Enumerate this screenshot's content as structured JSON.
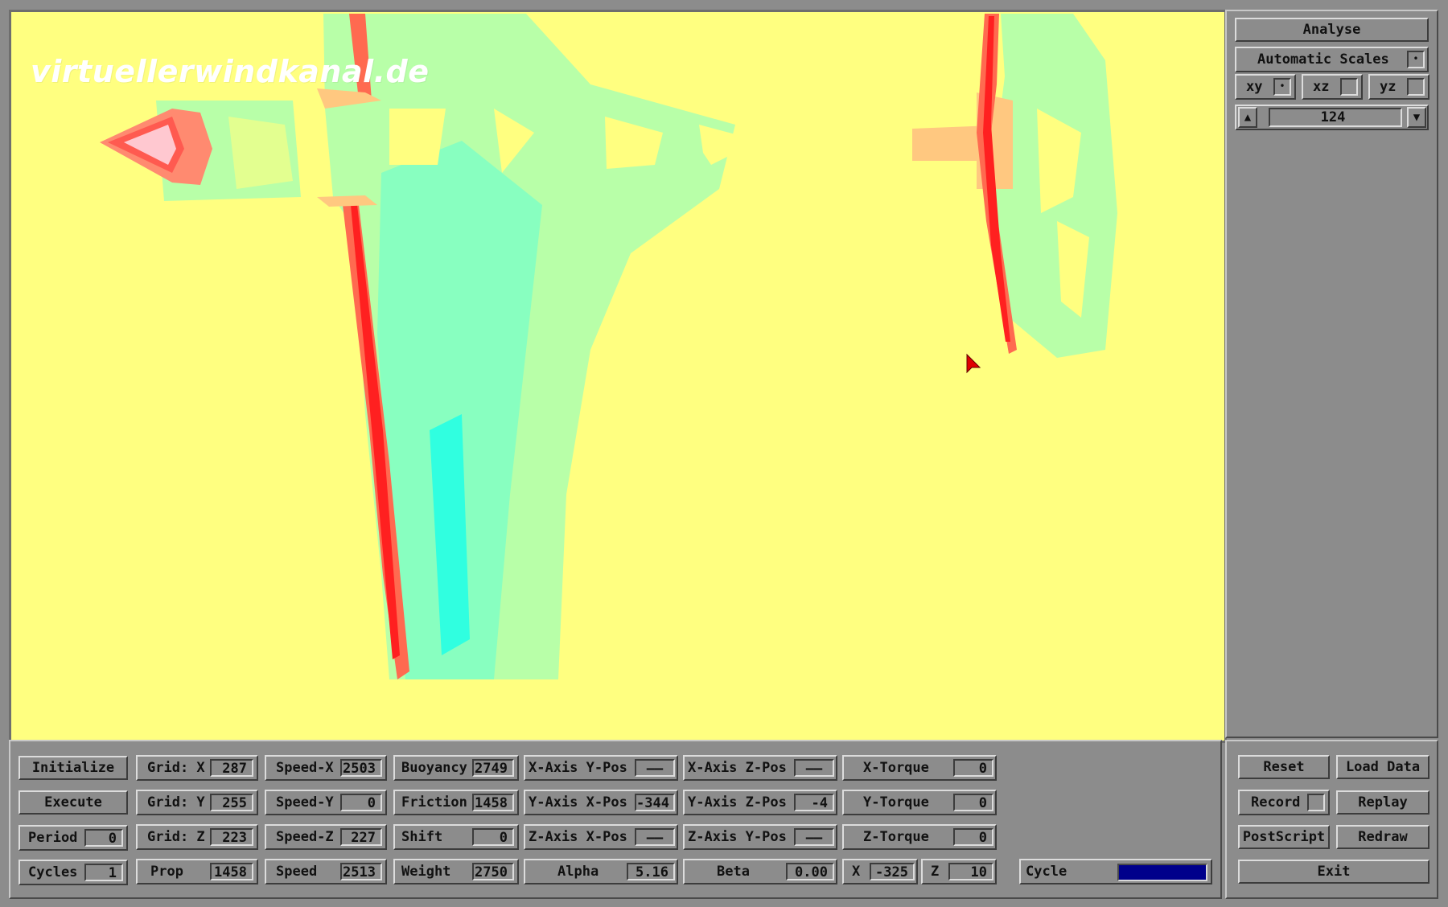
{
  "watermark": "virtuellerwindkanal.de",
  "colors": {
    "background": "#ffff80",
    "panel": "#8c8c8c",
    "cycle_bar": "#00008b"
  },
  "right_panel": {
    "analyse": "Analyse",
    "auto_scales": "Automatic Scales",
    "auto_scales_checked": true,
    "planes": [
      {
        "label": "xy",
        "checked": true
      },
      {
        "label": "xz",
        "checked": false
      },
      {
        "label": "yz",
        "checked": false
      }
    ],
    "slice_value": "124"
  },
  "bottom": {
    "initialize": "Initialize",
    "execute": "Execute",
    "period": {
      "label": "Period",
      "value": "0"
    },
    "cycles": {
      "label": "Cycles",
      "value": "1"
    },
    "grid_x": {
      "label": "Grid: X",
      "value": "287"
    },
    "grid_y": {
      "label": "Grid: Y",
      "value": "255"
    },
    "grid_z": {
      "label": "Grid: Z",
      "value": "223"
    },
    "prop": {
      "label": "Prop",
      "value": "1458"
    },
    "speed_x": {
      "label": "Speed-X",
      "value": "2503"
    },
    "speed_y": {
      "label": "Speed-Y",
      "value": "0"
    },
    "speed_z": {
      "label": "Speed-Z",
      "value": "227"
    },
    "speed": {
      "label": "Speed",
      "value": "2513"
    },
    "buoyancy": {
      "label": "Buoyancy",
      "value": "2749"
    },
    "friction": {
      "label": "Friction",
      "value": "1458"
    },
    "shift": {
      "label": "Shift",
      "value": "0"
    },
    "weight": {
      "label": "Weight",
      "value": "2750"
    },
    "xaxis_ypos": {
      "label": "X-Axis Y-Pos",
      "value": "——"
    },
    "yaxis_xpos": {
      "label": "Y-Axis X-Pos",
      "value": "-344"
    },
    "zaxis_xpos": {
      "label": "Z-Axis X-Pos",
      "value": "——"
    },
    "alpha": {
      "label": "Alpha",
      "value": "5.16"
    },
    "xaxis_zpos": {
      "label": "X-Axis Z-Pos",
      "value": "——"
    },
    "yaxis_zpos": {
      "label": "Y-Axis Z-Pos",
      "value": "-4"
    },
    "zaxis_ypos": {
      "label": "Z-Axis Y-Pos",
      "value": "——"
    },
    "beta": {
      "label": "Beta",
      "value": "0.00"
    },
    "x_torque": {
      "label": "X-Torque",
      "value": "0"
    },
    "y_torque": {
      "label": "Y-Torque",
      "value": "0"
    },
    "z_torque": {
      "label": "Z-Torque",
      "value": "0"
    },
    "x": {
      "label": "X",
      "value": "-325"
    },
    "z": {
      "label": "Z",
      "value": "10"
    },
    "cycle": {
      "label": "Cycle",
      "progress": 1.0
    }
  },
  "actions": {
    "reset": "Reset",
    "load_data": "Load Data",
    "record": "Record",
    "record_checked": false,
    "replay": "Replay",
    "postscript": "PostScript",
    "redraw": "Redraw",
    "exit": "Exit"
  }
}
